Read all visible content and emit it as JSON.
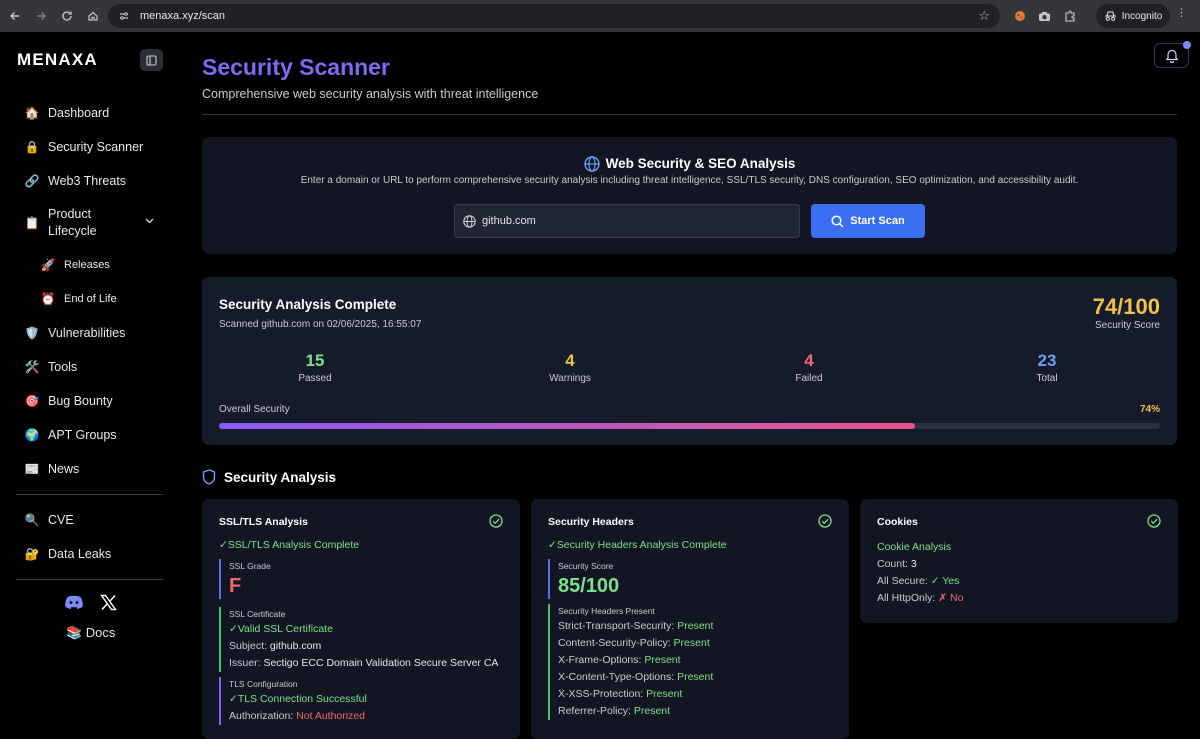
{
  "browser": {
    "url": "menaxa.xyz/scan",
    "incognito_label": "Incognito"
  },
  "sidebar": {
    "logo": "MENAXA",
    "items": [
      {
        "icon": "🏠",
        "label": "Dashboard"
      },
      {
        "icon": "🔒",
        "label": "Security Scanner"
      },
      {
        "icon": "🔗",
        "label": "Web3 Threats"
      },
      {
        "icon": "📋",
        "label": "Product Lifecycle"
      },
      {
        "icon": "🚀",
        "label": "Releases"
      },
      {
        "icon": "⏰",
        "label": "End of Life"
      },
      {
        "icon": "🛡️",
        "label": "Vulnerabilities"
      },
      {
        "icon": "🛠️",
        "label": "Tools"
      },
      {
        "icon": "🎯",
        "label": "Bug Bounty"
      },
      {
        "icon": "🌍",
        "label": "APT Groups"
      },
      {
        "icon": "📰",
        "label": "News"
      },
      {
        "icon": "🔍",
        "label": "CVE"
      },
      {
        "icon": "🔐",
        "label": "Data Leaks"
      }
    ],
    "docs": "📚 Docs"
  },
  "header": {
    "title": "Security Scanner",
    "subtitle": "Comprehensive web security analysis with threat intelligence"
  },
  "scan": {
    "title": "Web Security & SEO Analysis",
    "description": "Enter a domain or URL to perform comprehensive security analysis including threat intelligence, SSL/TLS security, DNS configuration, SEO optimization, and accessibility audit.",
    "input_value": "github.com",
    "button": "Start Scan"
  },
  "result": {
    "title": "Security Analysis Complete",
    "subtitle": "Scanned github.com on 02/06/2025, 16:55:07",
    "score": "74/100",
    "score_label": "Security Score",
    "stats": [
      {
        "value": "15",
        "label": "Passed",
        "color": "#7ee08a"
      },
      {
        "value": "4",
        "label": "Warnings",
        "color": "#f2c14a"
      },
      {
        "value": "4",
        "label": "Failed",
        "color": "#f06a6a"
      },
      {
        "value": "23",
        "label": "Total",
        "color": "#6ea0f5"
      }
    ],
    "overall_label": "Overall Security",
    "overall_pct": "74%",
    "overall_fraction": 0.74
  },
  "analysis": {
    "heading": "Security Analysis",
    "ssl": {
      "title": "SSL/TLS Analysis",
      "status": "✓SSL/TLS Analysis Complete",
      "grade_label": "SSL Grade",
      "grade": "F",
      "cert_label": "SSL Certificate",
      "cert_status": "✓Valid SSL Certificate",
      "subject_label": "Subject:",
      "subject": "github.com",
      "issuer_label": "Issuer:",
      "issuer": "Sectigo ECC Domain Validation Secure Server CA",
      "tls_label": "TLS Configuration",
      "tls_status": "✓TLS Connection Successful",
      "auth_label": "Authorization:",
      "auth": "Not Authorized"
    },
    "headers": {
      "title": "Security Headers",
      "status": "✓Security Headers Analysis Complete",
      "score_label": "Security Score",
      "score": "85/100",
      "present_label": "Security Headers Present",
      "rows": [
        {
          "name": "Strict-Transport-Security:",
          "value": "Present"
        },
        {
          "name": "Content-Security-Policy:",
          "value": "Present"
        },
        {
          "name": "X-Frame-Options:",
          "value": "Present"
        },
        {
          "name": "X-Content-Type-Options:",
          "value": "Present"
        },
        {
          "name": "X-XSS-Protection:",
          "value": "Present"
        },
        {
          "name": "Referrer-Policy:",
          "value": "Present"
        }
      ]
    },
    "cookies": {
      "title": "Cookies",
      "status": "Cookie Analysis",
      "count_label": "Count:",
      "count": "3",
      "secure_label": "All Secure:",
      "secure": "✓ Yes",
      "httponly_label": "All HttpOnly:",
      "httponly": "✗ No"
    }
  }
}
